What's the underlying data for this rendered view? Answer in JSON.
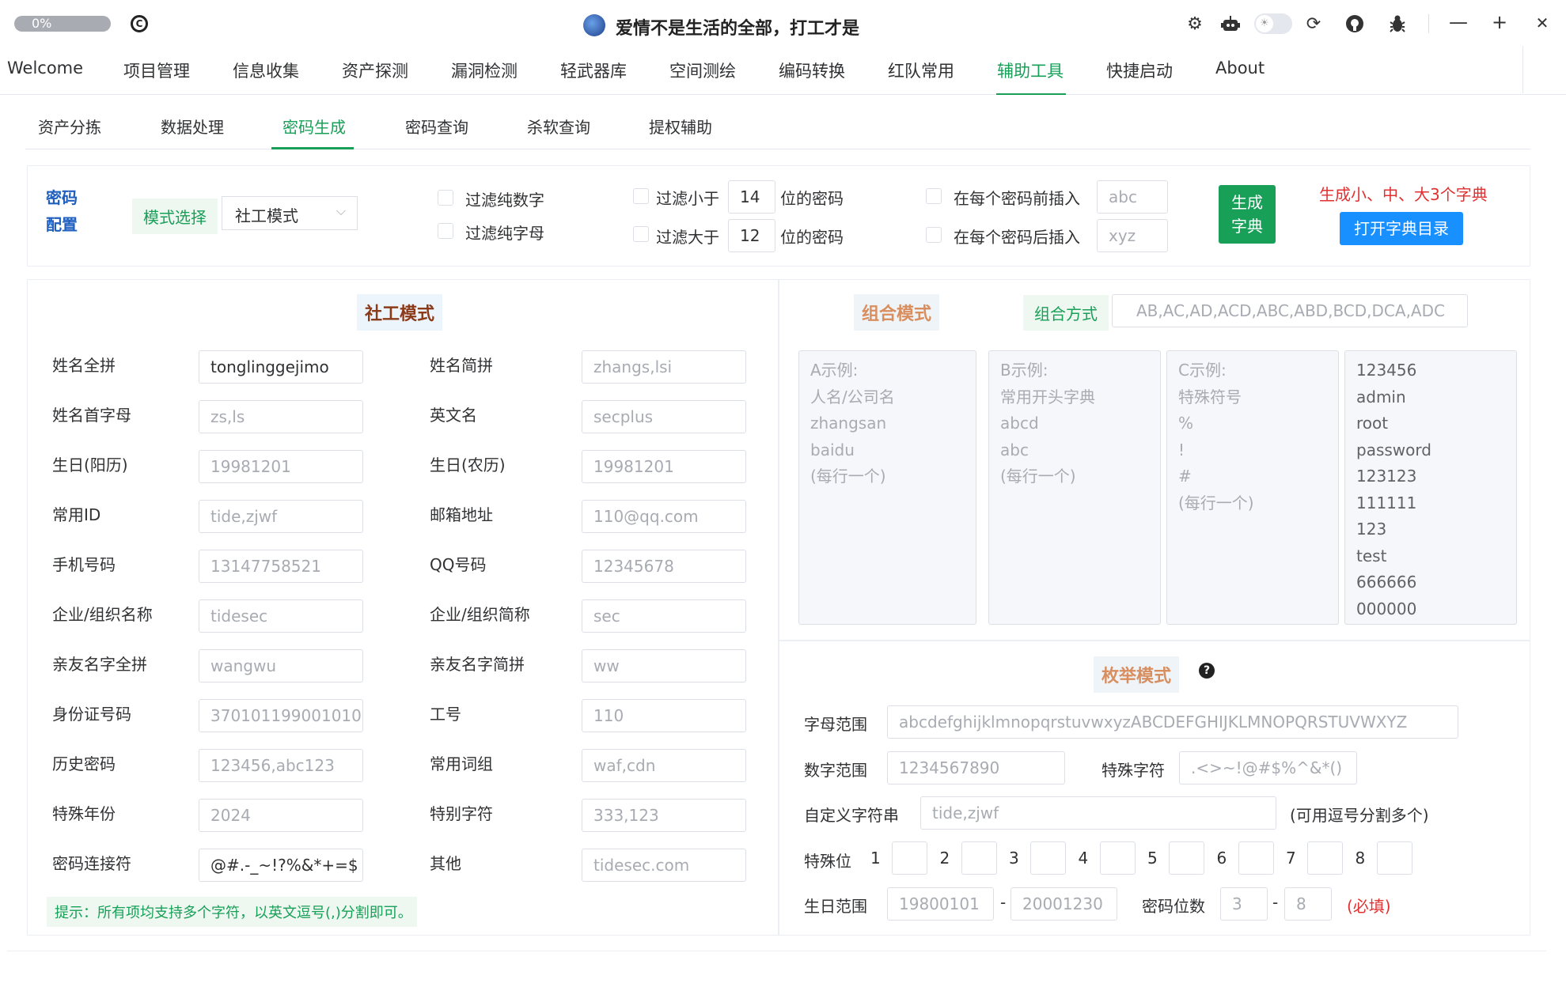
{
  "titlebar": {
    "progress": "0%",
    "title": "爱情不是生活的全部，打工才是",
    "icons": [
      "gear-icon",
      "robot-icon",
      "sun-icon",
      "refresh-icon",
      "github-icon",
      "bug-icon"
    ],
    "minimize": "—",
    "maximize": "+",
    "close": "✕"
  },
  "menu": [
    "Welcome",
    "项目管理",
    "信息收集",
    "资产探测",
    "漏洞检测",
    "轻武器库",
    "空间测绘",
    "编码转换",
    "红队常用",
    "辅助工具",
    "快捷启动",
    "About"
  ],
  "subtabs": [
    "资产分拣",
    "数据处理",
    "密码生成",
    "密码查询",
    "杀软查询",
    "提权辅助"
  ],
  "config": {
    "title_line1": "密码",
    "title_line2": "配置",
    "mode_label": "模式选择",
    "mode_value": "社工模式",
    "filter_digits": "过滤纯数字",
    "filter_letters": "过滤纯字母",
    "filter_less": "过滤小于",
    "filter_less_value": "14",
    "filter_greater": "过滤大于",
    "filter_greater_value": "12",
    "pwd_suffix": "位的密码",
    "insert_before": "在每个密码前插入",
    "insert_before_ph": "abc",
    "insert_after": "在每个密码后插入",
    "insert_after_ph": "xyz",
    "gen_line1": "生成",
    "gen_line2": "字典",
    "gen_note": "生成小、中、大3个字典",
    "open_dir": "打开字典目录"
  },
  "social": {
    "title": "社工模式",
    "fields": [
      {
        "label": "姓名全拼",
        "value": "tonglinggejimo",
        "placeholder": ""
      },
      {
        "label": "姓名简拼",
        "value": "",
        "placeholder": "zhangs,lsi"
      },
      {
        "label": "姓名首字母",
        "value": "",
        "placeholder": "zs,ls"
      },
      {
        "label": "英文名",
        "value": "",
        "placeholder": "secplus"
      },
      {
        "label": "生日(阳历)",
        "value": "",
        "placeholder": "19981201"
      },
      {
        "label": "生日(农历)",
        "value": "",
        "placeholder": "19981201"
      },
      {
        "label": "常用ID",
        "value": "",
        "placeholder": "tide,zjwf"
      },
      {
        "label": "邮箱地址",
        "value": "",
        "placeholder": "110@qq.com"
      },
      {
        "label": "手机号码",
        "value": "",
        "placeholder": "13147758521"
      },
      {
        "label": "QQ号码",
        "value": "",
        "placeholder": "12345678"
      },
      {
        "label": "企业/组织名称",
        "value": "",
        "placeholder": "tidesec"
      },
      {
        "label": "企业/组织简称",
        "value": "",
        "placeholder": "sec"
      },
      {
        "label": "亲友名字全拼",
        "value": "",
        "placeholder": "wangwu"
      },
      {
        "label": "亲友名字简拼",
        "value": "",
        "placeholder": "ww"
      },
      {
        "label": "身份证号码",
        "value": "",
        "placeholder": "370101199001010"
      },
      {
        "label": "工号",
        "value": "",
        "placeholder": "110"
      },
      {
        "label": "历史密码",
        "value": "",
        "placeholder": "123456,abc123"
      },
      {
        "label": "常用词组",
        "value": "",
        "placeholder": "waf,cdn"
      },
      {
        "label": "特殊年份",
        "value": "",
        "placeholder": "2024"
      },
      {
        "label": "特别字符",
        "value": "",
        "placeholder": "333,123"
      },
      {
        "label": "密码连接符",
        "value": "@#.-_~!?%&*+=$",
        "placeholder": ""
      },
      {
        "label": "其他",
        "value": "",
        "placeholder": "tidesec.com"
      }
    ],
    "tip": "提示：所有项均支持多个字符，以英文逗号(,)分割即可。"
  },
  "combo": {
    "title": "组合模式",
    "method_label": "组合方式",
    "method_placeholder": "AB,AC,AD,ACD,ABC,ABD,BCD,DCA,ADC",
    "a_placeholder": "A示例:\n人名/公司名\nzhangsan\nbaidu\n(每行一个)",
    "b_placeholder": "B示例:\n常用开头字典\nabcd\nabc\n(每行一个)",
    "c_placeholder": "C示例:\n特殊符号\n%\n!\n#\n(每行一个)",
    "d_value": "123456\nadmin\nroot\npassword\n123123\n111111\n123\ntest\n666666\n000000"
  },
  "enum": {
    "title": "枚举模式",
    "letters_label": "字母范围",
    "letters_ph": "abcdefghijklmnopqrstuvwxyzABCDEFGHIJKLMNOPQRSTUVWXYZ",
    "digits_label": "数字范围",
    "digits_ph": "1234567890",
    "special_label": "特殊字符",
    "special_ph": ".<>~!@#$%^&*()",
    "custom_label": "自定义字符串",
    "custom_ph": "tide,zjwf",
    "custom_note": "(可用逗号分割多个)",
    "special_pos_label": "特殊位",
    "positions": [
      "1",
      "2",
      "3",
      "4",
      "5",
      "6",
      "7",
      "8"
    ],
    "birthday_label": "生日范围",
    "birthday_from_ph": "19800101",
    "birthday_to_ph": "20001230",
    "dash": "-",
    "length_label": "密码位数",
    "length_from_ph": "3",
    "length_to_ph": "8",
    "required": "(必填)"
  }
}
